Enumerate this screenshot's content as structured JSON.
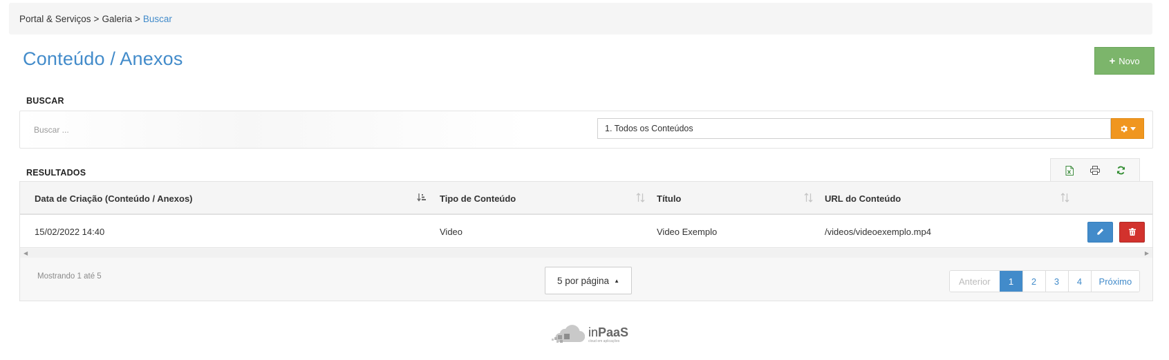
{
  "breadcrumb": {
    "items": [
      "Portal & Serviços",
      "Galeria"
    ],
    "separator": ">",
    "active": "Buscar"
  },
  "page": {
    "title": "Conteúdo / Anexos",
    "new_button_label": "Novo"
  },
  "search": {
    "section_label": "BUSCAR",
    "placeholder": "Buscar ...",
    "filter_value": "1. Todos os Conteúdos",
    "settings_icon": "gear-icon"
  },
  "results": {
    "section_label": "RESULTADOS",
    "toolbar_icons": [
      "excel-icon",
      "print-icon",
      "refresh-icon"
    ],
    "columns": [
      {
        "label": "Data de Criação (Conteúdo / Anexos)",
        "sort": "sorted-desc"
      },
      {
        "label": "Tipo de Conteúdo",
        "sort": "unsorted"
      },
      {
        "label": "Título",
        "sort": "unsorted"
      },
      {
        "label": "URL do Conteúdo",
        "sort": "unsorted"
      }
    ],
    "rows": [
      {
        "data_criacao": "15/02/2022 14:40",
        "tipo": "Video",
        "titulo": "Video Exemplo",
        "url": "/videos/videoexemplo.mp4"
      }
    ],
    "showing_text": "Mostrando 1 até 5",
    "per_page_label": "5 por página",
    "pagination": {
      "prev": "Anterior",
      "pages": [
        "1",
        "2",
        "3",
        "4"
      ],
      "current": "1",
      "next": "Próximo"
    }
  },
  "logo": {
    "prefix": "in",
    "brand": "PaaS",
    "tagline": "cloud em aplicações"
  },
  "colors": {
    "primary": "#428bca",
    "success": "#7cb56b",
    "warning": "#f0961f",
    "danger": "#d2322d"
  }
}
